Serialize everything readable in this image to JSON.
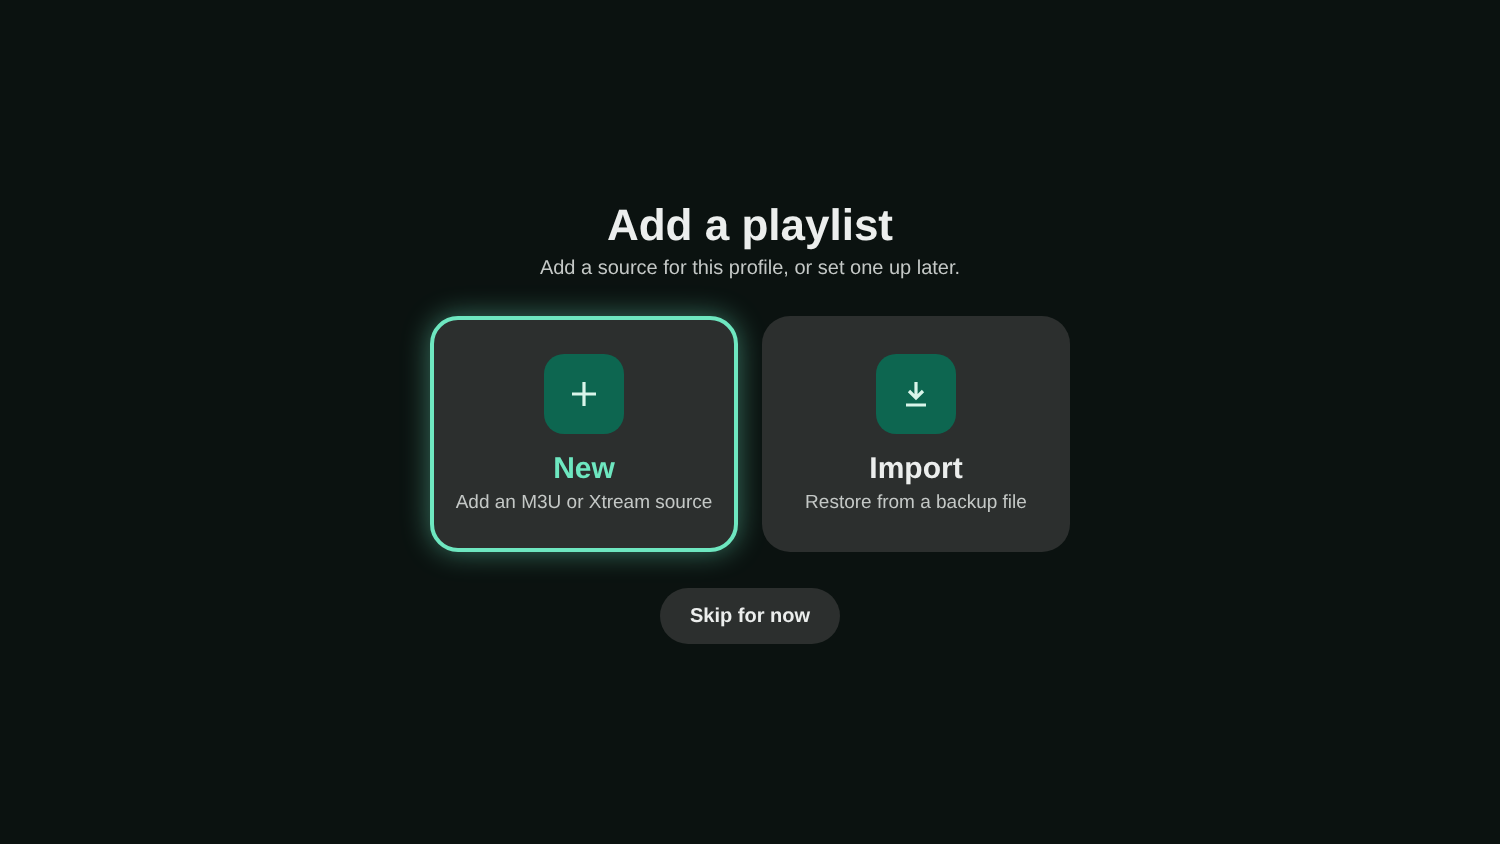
{
  "title": "Add a playlist",
  "subtitle": "Add a source for this profile, or set one up later.",
  "options": [
    {
      "kind": "new",
      "label": "New",
      "description": "Add an M3U or Xtream source",
      "selected": true
    },
    {
      "kind": "import",
      "label": "Import",
      "description": "Restore from a backup file",
      "selected": false
    }
  ],
  "skip_button": "Skip for now"
}
